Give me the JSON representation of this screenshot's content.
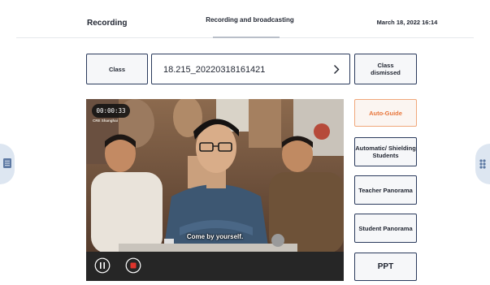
{
  "header": {
    "left_title": "Recording",
    "center_title": "Recording and broadcasting",
    "datetime": "March 18, 2022 16:14"
  },
  "side_handles": {
    "left_icon": "list-icon",
    "right_icon": "grid-icon"
  },
  "class_selector": {
    "class_label": "Class",
    "selected_value": "18.215_20220318161421",
    "chevron_icon": "chevron-right-icon",
    "dismiss_label": "Class dismissed"
  },
  "video": {
    "timer": "00:00:33",
    "watermark": "CRE Shanghai",
    "subtitle": "Come by yourself.",
    "pause_icon": "pause-icon",
    "stop_icon": "stop-icon"
  },
  "camera_modes": {
    "auto_guide": "Auto-Guide",
    "shielding": "Automatic/ Shielding Students",
    "teacher": "Teacher Panorama",
    "student": "Student Panorama",
    "ppt": "PPT"
  },
  "colors": {
    "accent_orange": "#e8753a",
    "border_navy": "#2a3a5c",
    "side_handle": "#dde6f1",
    "control_bar": "#262626"
  }
}
